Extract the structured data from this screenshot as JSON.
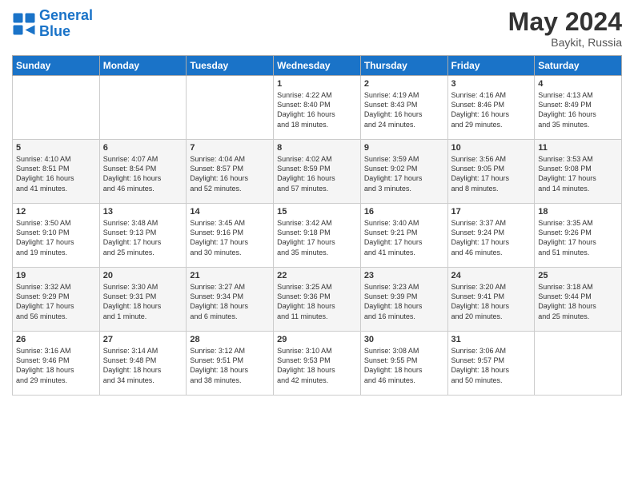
{
  "header": {
    "logo_line1": "General",
    "logo_line2": "Blue",
    "month_year": "May 2024",
    "location": "Baykit, Russia"
  },
  "days_of_week": [
    "Sunday",
    "Monday",
    "Tuesday",
    "Wednesday",
    "Thursday",
    "Friday",
    "Saturday"
  ],
  "weeks": [
    [
      {
        "num": "",
        "info": ""
      },
      {
        "num": "",
        "info": ""
      },
      {
        "num": "",
        "info": ""
      },
      {
        "num": "1",
        "info": "Sunrise: 4:22 AM\nSunset: 8:40 PM\nDaylight: 16 hours\nand 18 minutes."
      },
      {
        "num": "2",
        "info": "Sunrise: 4:19 AM\nSunset: 8:43 PM\nDaylight: 16 hours\nand 24 minutes."
      },
      {
        "num": "3",
        "info": "Sunrise: 4:16 AM\nSunset: 8:46 PM\nDaylight: 16 hours\nand 29 minutes."
      },
      {
        "num": "4",
        "info": "Sunrise: 4:13 AM\nSunset: 8:49 PM\nDaylight: 16 hours\nand 35 minutes."
      }
    ],
    [
      {
        "num": "5",
        "info": "Sunrise: 4:10 AM\nSunset: 8:51 PM\nDaylight: 16 hours\nand 41 minutes."
      },
      {
        "num": "6",
        "info": "Sunrise: 4:07 AM\nSunset: 8:54 PM\nDaylight: 16 hours\nand 46 minutes."
      },
      {
        "num": "7",
        "info": "Sunrise: 4:04 AM\nSunset: 8:57 PM\nDaylight: 16 hours\nand 52 minutes."
      },
      {
        "num": "8",
        "info": "Sunrise: 4:02 AM\nSunset: 8:59 PM\nDaylight: 16 hours\nand 57 minutes."
      },
      {
        "num": "9",
        "info": "Sunrise: 3:59 AM\nSunset: 9:02 PM\nDaylight: 17 hours\nand 3 minutes."
      },
      {
        "num": "10",
        "info": "Sunrise: 3:56 AM\nSunset: 9:05 PM\nDaylight: 17 hours\nand 8 minutes."
      },
      {
        "num": "11",
        "info": "Sunrise: 3:53 AM\nSunset: 9:08 PM\nDaylight: 17 hours\nand 14 minutes."
      }
    ],
    [
      {
        "num": "12",
        "info": "Sunrise: 3:50 AM\nSunset: 9:10 PM\nDaylight: 17 hours\nand 19 minutes."
      },
      {
        "num": "13",
        "info": "Sunrise: 3:48 AM\nSunset: 9:13 PM\nDaylight: 17 hours\nand 25 minutes."
      },
      {
        "num": "14",
        "info": "Sunrise: 3:45 AM\nSunset: 9:16 PM\nDaylight: 17 hours\nand 30 minutes."
      },
      {
        "num": "15",
        "info": "Sunrise: 3:42 AM\nSunset: 9:18 PM\nDaylight: 17 hours\nand 35 minutes."
      },
      {
        "num": "16",
        "info": "Sunrise: 3:40 AM\nSunset: 9:21 PM\nDaylight: 17 hours\nand 41 minutes."
      },
      {
        "num": "17",
        "info": "Sunrise: 3:37 AM\nSunset: 9:24 PM\nDaylight: 17 hours\nand 46 minutes."
      },
      {
        "num": "18",
        "info": "Sunrise: 3:35 AM\nSunset: 9:26 PM\nDaylight: 17 hours\nand 51 minutes."
      }
    ],
    [
      {
        "num": "19",
        "info": "Sunrise: 3:32 AM\nSunset: 9:29 PM\nDaylight: 17 hours\nand 56 minutes."
      },
      {
        "num": "20",
        "info": "Sunrise: 3:30 AM\nSunset: 9:31 PM\nDaylight: 18 hours\nand 1 minute."
      },
      {
        "num": "21",
        "info": "Sunrise: 3:27 AM\nSunset: 9:34 PM\nDaylight: 18 hours\nand 6 minutes."
      },
      {
        "num": "22",
        "info": "Sunrise: 3:25 AM\nSunset: 9:36 PM\nDaylight: 18 hours\nand 11 minutes."
      },
      {
        "num": "23",
        "info": "Sunrise: 3:23 AM\nSunset: 9:39 PM\nDaylight: 18 hours\nand 16 minutes."
      },
      {
        "num": "24",
        "info": "Sunrise: 3:20 AM\nSunset: 9:41 PM\nDaylight: 18 hours\nand 20 minutes."
      },
      {
        "num": "25",
        "info": "Sunrise: 3:18 AM\nSunset: 9:44 PM\nDaylight: 18 hours\nand 25 minutes."
      }
    ],
    [
      {
        "num": "26",
        "info": "Sunrise: 3:16 AM\nSunset: 9:46 PM\nDaylight: 18 hours\nand 29 minutes."
      },
      {
        "num": "27",
        "info": "Sunrise: 3:14 AM\nSunset: 9:48 PM\nDaylight: 18 hours\nand 34 minutes."
      },
      {
        "num": "28",
        "info": "Sunrise: 3:12 AM\nSunset: 9:51 PM\nDaylight: 18 hours\nand 38 minutes."
      },
      {
        "num": "29",
        "info": "Sunrise: 3:10 AM\nSunset: 9:53 PM\nDaylight: 18 hours\nand 42 minutes."
      },
      {
        "num": "30",
        "info": "Sunrise: 3:08 AM\nSunset: 9:55 PM\nDaylight: 18 hours\nand 46 minutes."
      },
      {
        "num": "31",
        "info": "Sunrise: 3:06 AM\nSunset: 9:57 PM\nDaylight: 18 hours\nand 50 minutes."
      },
      {
        "num": "",
        "info": ""
      }
    ]
  ]
}
